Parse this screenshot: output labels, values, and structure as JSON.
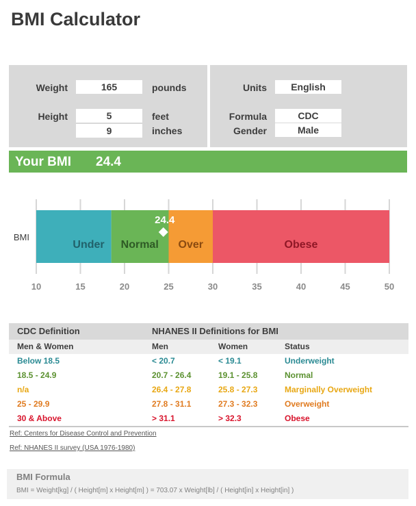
{
  "page": {
    "title": "BMI Calculator"
  },
  "inputs": {
    "weight": {
      "label": "Weight",
      "value": "165",
      "unit": "pounds"
    },
    "height": {
      "label": "Height",
      "feet_value": "5",
      "feet_unit": "feet",
      "inches_value": "9",
      "inches_unit": "inches"
    },
    "units": {
      "label": "Units",
      "value": "English"
    },
    "formula": {
      "label": "Formula",
      "value": "CDC"
    },
    "gender": {
      "label": "Gender",
      "value": "Male"
    }
  },
  "result": {
    "label": "Your BMI",
    "value": "24.4",
    "bar_color": "#6ab556"
  },
  "chart_data": {
    "type": "bar",
    "orientation": "horizontal-stacked-ranges",
    "category": "BMI",
    "xlim": [
      10,
      50
    ],
    "ticks": [
      10,
      15,
      20,
      25,
      30,
      35,
      40,
      45,
      50
    ],
    "grid": true,
    "ranges": [
      {
        "name": "Under",
        "from": 10,
        "to": 18.5,
        "color": "#3eafba",
        "text_color": "#21616a"
      },
      {
        "name": "Normal",
        "from": 18.5,
        "to": 25,
        "color": "#6ab556",
        "text_color": "#2e5a25"
      },
      {
        "name": "Over",
        "from": 25,
        "to": 30,
        "color": "#f59b35",
        "text_color": "#8a4a10"
      },
      {
        "name": "Obese",
        "from": 30,
        "to": 50,
        "color": "#ec5766",
        "text_color": "#8f1726"
      }
    ],
    "marker": {
      "value": 24.4,
      "label": "24.4",
      "shape": "diamond",
      "color": "#ffffff"
    }
  },
  "table": {
    "header1": [
      "CDC Definition",
      "NHANES II Definitions for BMI"
    ],
    "header2": [
      "Men & Women",
      "Men",
      "Women",
      "Status"
    ],
    "rows": [
      {
        "cells": [
          "Below 18.5",
          "< 20.7",
          "< 19.1",
          "Underweight"
        ],
        "color": "#2a8a93"
      },
      {
        "cells": [
          "18.5 - 24.9",
          "20.7 - 26.4",
          "19.1 - 25.8",
          "Normal"
        ],
        "color": "#5b9130"
      },
      {
        "cells": [
          "n/a",
          "26.4 - 27.8",
          "25.8 - 27.3",
          "Marginally Overweight"
        ],
        "color": "#e8a713"
      },
      {
        "cells": [
          "25 - 29.9",
          "27.8 - 31.1",
          "27.3 - 32.3",
          "Overweight"
        ],
        "color": "#e07b20"
      },
      {
        "cells": [
          "30 & Above",
          "> 31.1",
          "> 32.3",
          "Obese"
        ],
        "color": "#d8142c"
      }
    ]
  },
  "references": [
    "Ref: Centers for Disease Control and Prevention",
    "Ref: NHANES II survey (USA 1976-1980)"
  ],
  "formula_box": {
    "title": "BMI Formula",
    "text": "BMI = Weight[kg] / ( Height[m] x Height[m] ) = 703.07 x Weight[lb] / ( Height[in] x Height[in] )"
  }
}
